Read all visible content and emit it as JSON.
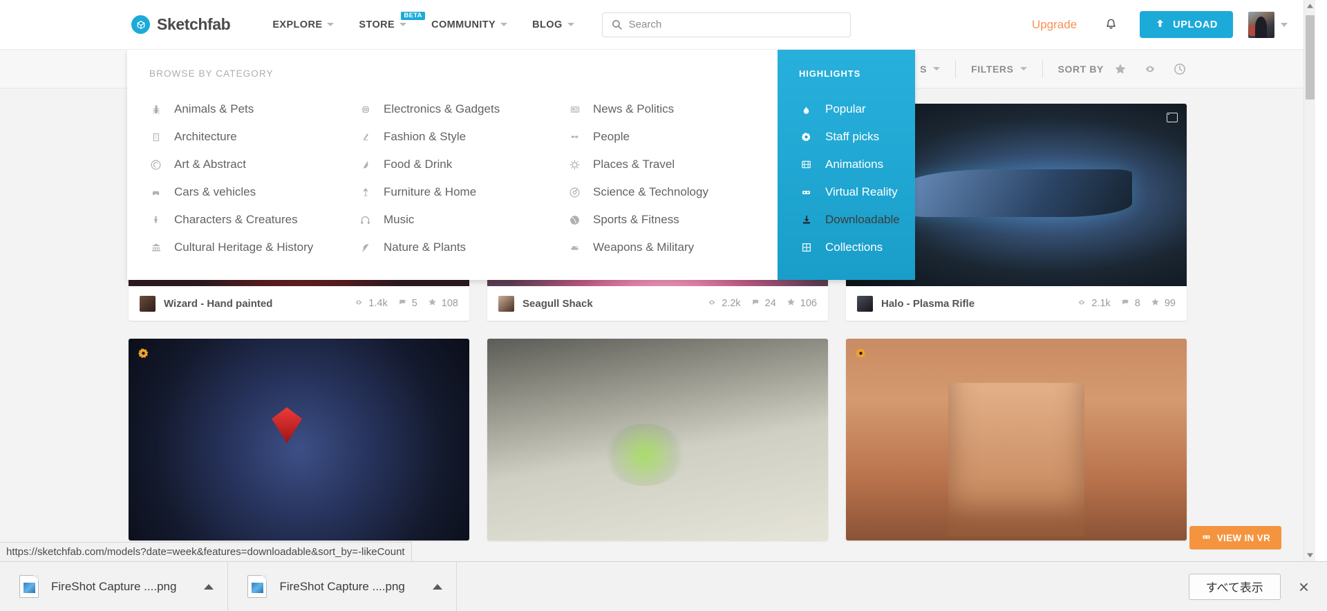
{
  "header": {
    "logo_text": "Sketchfab",
    "nav": [
      {
        "label": "EXPLORE",
        "badge": ""
      },
      {
        "label": "STORE",
        "badge": "BETA"
      },
      {
        "label": "COMMUNITY",
        "badge": ""
      },
      {
        "label": "BLOG",
        "badge": ""
      }
    ],
    "search_placeholder": "Search",
    "search_value": "",
    "upgrade_label": "Upgrade",
    "upload_label": "UPLOAD"
  },
  "mega_menu": {
    "browse_title": "BROWSE BY CATEGORY",
    "columns": [
      [
        {
          "label": "Animals & Pets",
          "icon": "bug-icon"
        },
        {
          "label": "Architecture",
          "icon": "building-icon"
        },
        {
          "label": "Art & Abstract",
          "icon": "spiral-icon"
        },
        {
          "label": "Cars & vehicles",
          "icon": "car-icon"
        },
        {
          "label": "Characters & Creatures",
          "icon": "person-icon"
        },
        {
          "label": "Cultural Heritage & History",
          "icon": "museum-icon"
        }
      ],
      [
        {
          "label": "Electronics & Gadgets",
          "icon": "chip-icon"
        },
        {
          "label": "Fashion & Style",
          "icon": "highheel-icon"
        },
        {
          "label": "Food & Drink",
          "icon": "pizza-icon"
        },
        {
          "label": "Furniture & Home",
          "icon": "lamp-icon"
        },
        {
          "label": "Music",
          "icon": "headphones-icon"
        },
        {
          "label": "Nature & Plants",
          "icon": "leaf-icon"
        }
      ],
      [
        {
          "label": "News & Politics",
          "icon": "newspaper-icon"
        },
        {
          "label": "People",
          "icon": "glasses-icon"
        },
        {
          "label": "Places & Travel",
          "icon": "sun-icon"
        },
        {
          "label": "Science & Technology",
          "icon": "atom-icon"
        },
        {
          "label": "Sports & Fitness",
          "icon": "ball-icon"
        },
        {
          "label": "Weapons & Military",
          "icon": "tank-icon"
        }
      ]
    ],
    "highlights_title": "HIGHLIGHTS",
    "highlights": [
      {
        "label": "Popular",
        "icon": "flame-icon",
        "hover": false
      },
      {
        "label": "Staff picks",
        "icon": "badge-icon",
        "hover": false
      },
      {
        "label": "Animations",
        "icon": "film-icon",
        "hover": false
      },
      {
        "label": "Virtual Reality",
        "icon": "vr-goggles-icon",
        "hover": false
      },
      {
        "label": "Downloadable",
        "icon": "download-icon",
        "hover": true
      },
      {
        "label": "Collections",
        "icon": "grid-icon",
        "hover": false
      }
    ],
    "accent_color": "#28b0dc"
  },
  "filter_bar": {
    "categories_label": "S",
    "filters_label": "FILTERS",
    "sort_by_label": "SORT BY",
    "icons": [
      "star-icon",
      "eye-icon",
      "clock-icon"
    ]
  },
  "models": [
    {
      "name": "Wizard - Hand painted",
      "views": "1.4k",
      "comments": "5",
      "likes": "108",
      "thumb_class": "th-wizard",
      "staff_pick": false,
      "animated": false
    },
    {
      "name": "Seagull Shack",
      "views": "2.2k",
      "comments": "24",
      "likes": "106",
      "thumb_class": "th-seagull",
      "staff_pick": false,
      "animated": false
    },
    {
      "name": "Halo - Plasma Rifle",
      "views": "2.1k",
      "comments": "8",
      "likes": "99",
      "thumb_class": "th-halo",
      "staff_pick": false,
      "animated": true
    },
    {
      "name": "",
      "views": "",
      "comments": "",
      "likes": "",
      "thumb_class": "th-golem",
      "staff_pick": true,
      "animated": false
    },
    {
      "name": "",
      "views": "",
      "comments": "",
      "likes": "",
      "thumb_class": "th-ruins",
      "staff_pick": false,
      "animated": false
    },
    {
      "name": "",
      "views": "",
      "comments": "",
      "likes": "",
      "thumb_class": "th-petra",
      "staff_pick": true,
      "animated": false
    }
  ],
  "vr_button": {
    "label": "VIEW IN VR",
    "color": "#f4943f"
  },
  "status_url": "https://sketchfab.com/models?date=week&features=downloadable&sort_by=-likeCount",
  "download_bar": {
    "items": [
      {
        "name": "FireShot Capture ....png"
      },
      {
        "name": "FireShot Capture ....png"
      }
    ],
    "show_all_label": "すべて表示",
    "close_label": "×"
  }
}
